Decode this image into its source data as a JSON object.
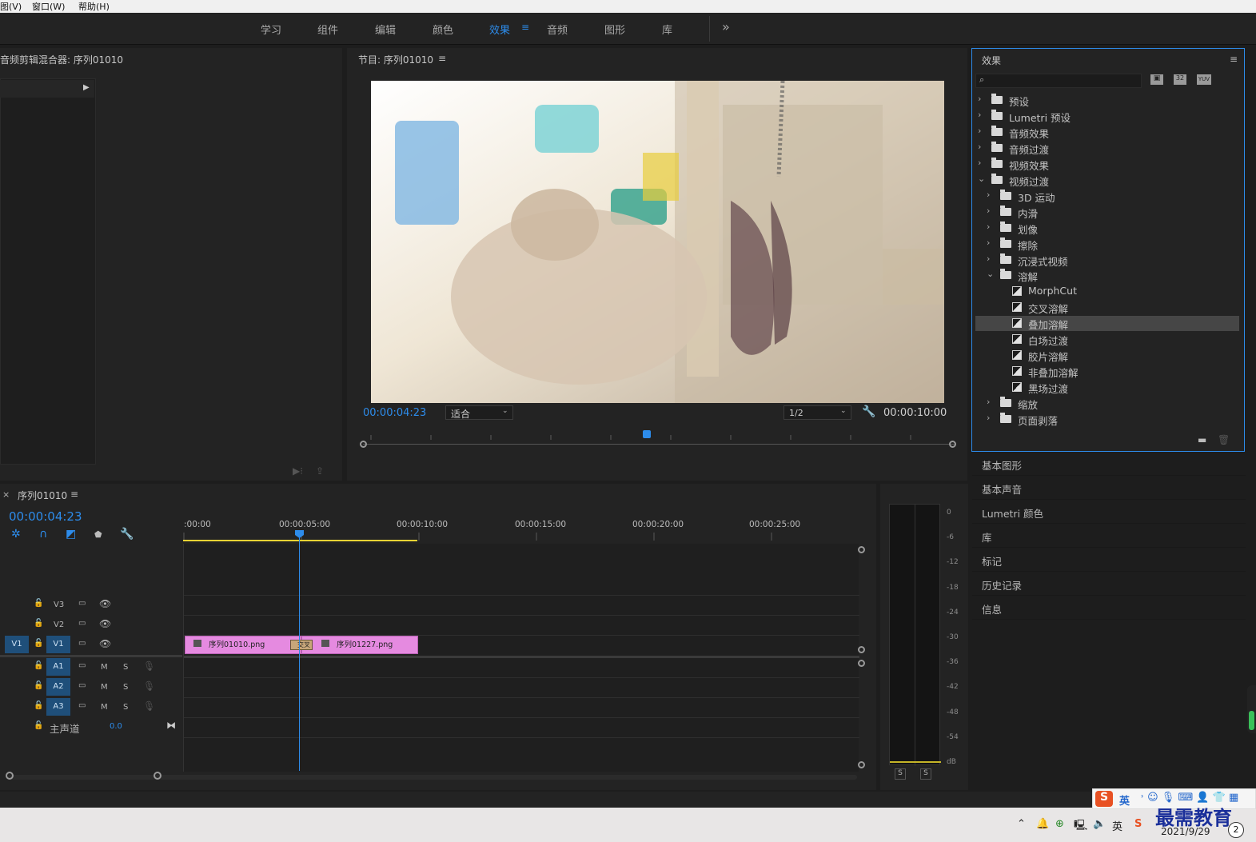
{
  "menu": {
    "view": "图(V)",
    "window": "窗口(W)",
    "help": "帮助(H)"
  },
  "workspace": {
    "tabs": [
      "学习",
      "组件",
      "编辑",
      "颜色",
      "效果",
      "音频",
      "图形",
      "库"
    ],
    "active": "效果",
    "more": "»"
  },
  "audio_mixer": {
    "title": "音频剪辑混合器: 序列01010"
  },
  "program_monitor": {
    "title": "节目: 序列01010",
    "timecode": "00:00:04:23",
    "fit": "适合",
    "resolution": "1/2",
    "duration": "00:00:10:00",
    "playhead_fraction": 0.48
  },
  "effects_panel": {
    "title": "效果",
    "badges": [
      "32",
      "YUV"
    ],
    "tree": [
      {
        "label": "预设",
        "level": 0,
        "type": "preset",
        "open": false
      },
      {
        "label": "Lumetri 预设",
        "level": 0,
        "type": "preset",
        "open": false
      },
      {
        "label": "音频效果",
        "level": 0,
        "type": "folder",
        "open": false
      },
      {
        "label": "音频过渡",
        "level": 0,
        "type": "folder",
        "open": false
      },
      {
        "label": "视频效果",
        "level": 0,
        "type": "folder",
        "open": false
      },
      {
        "label": "视频过渡",
        "level": 0,
        "type": "folder",
        "open": true
      },
      {
        "label": "3D 运动",
        "level": 1,
        "type": "folder",
        "open": false
      },
      {
        "label": "内滑",
        "level": 1,
        "type": "folder",
        "open": false
      },
      {
        "label": "划像",
        "level": 1,
        "type": "folder",
        "open": false
      },
      {
        "label": "擦除",
        "level": 1,
        "type": "folder",
        "open": false
      },
      {
        "label": "沉浸式视频",
        "level": 1,
        "type": "folder",
        "open": false
      },
      {
        "label": "溶解",
        "level": 1,
        "type": "folder",
        "open": true
      },
      {
        "label": "MorphCut",
        "level": 2,
        "type": "effect"
      },
      {
        "label": "交叉溶解",
        "level": 2,
        "type": "effect"
      },
      {
        "label": "叠加溶解",
        "level": 2,
        "type": "effect",
        "selected": true
      },
      {
        "label": "白场过渡",
        "level": 2,
        "type": "effect"
      },
      {
        "label": "胶片溶解",
        "level": 2,
        "type": "effect"
      },
      {
        "label": "非叠加溶解",
        "level": 2,
        "type": "effect"
      },
      {
        "label": "黑场过渡",
        "level": 2,
        "type": "effect"
      },
      {
        "label": "缩放",
        "level": 1,
        "type": "folder",
        "open": false
      },
      {
        "label": "页面剥落",
        "level": 1,
        "type": "folder",
        "open": false
      }
    ]
  },
  "side_panels": [
    "基本图形",
    "基本声音",
    "Lumetri 颜色",
    "库",
    "标记",
    "历史记录",
    "信息"
  ],
  "timeline": {
    "title": "序列01010",
    "timecode": "00:00:04:23",
    "ruler": [
      ":00:00",
      "00:00:05:00",
      "00:00:10:00",
      "00:00:15:00",
      "00:00:20:00",
      "00:00:25:00"
    ],
    "video_tracks": [
      "V3",
      "V2",
      "V1"
    ],
    "source_badge": "V1",
    "audio_tracks": [
      "A1",
      "A2",
      "A3"
    ],
    "m": "M",
    "s": "S",
    "master": {
      "label": "主声道",
      "value": "0.0"
    },
    "clips": [
      {
        "name": "序列01010.png"
      },
      {
        "name": "序列01227.png"
      }
    ],
    "transition_label": "交叉"
  },
  "meter": {
    "scale": [
      "0",
      "-6",
      "-12",
      "-18",
      "-24",
      "-30",
      "-36",
      "-42",
      "-48",
      "-54",
      "dB"
    ],
    "solo": [
      "S",
      "S"
    ]
  },
  "taskbar": {
    "ime": "英",
    "date": "2021/9/29",
    "watermark": "最需教育",
    "badge": "2"
  },
  "colors": {
    "accent": "#2d8ceb",
    "clip": "#e58ae0",
    "work_area": "#e8d234",
    "track_badge": "#1f4f7a"
  }
}
